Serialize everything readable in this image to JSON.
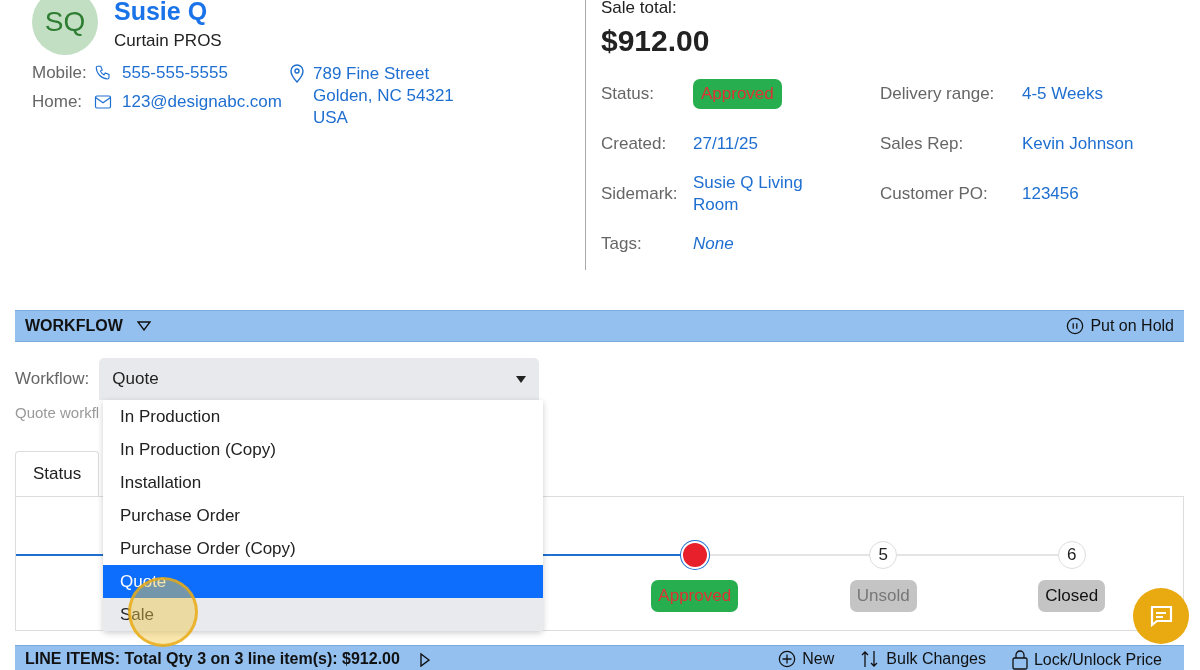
{
  "customer": {
    "initials": "SQ",
    "name": "Susie Q",
    "company": "Curtain PROS",
    "contacts": [
      {
        "kind": "phone",
        "label": "Mobile:",
        "value": "555-555-5555"
      },
      {
        "kind": "email",
        "label": "Home:",
        "value": "123@designabc.com"
      }
    ],
    "address": [
      "789 Fine Street",
      "Golden, NC 54321",
      "USA"
    ]
  },
  "sale": {
    "total_label": "Sale total:",
    "total": "$912.00",
    "fields": [
      {
        "label": "Status:",
        "value": "Approved",
        "kind": "badge"
      },
      {
        "label": "Delivery range:",
        "value": "4-5 Weeks",
        "kind": "link"
      },
      {
        "label": "Created:",
        "value": "27/11/25",
        "kind": "link"
      },
      {
        "label": "Sales Rep:",
        "value": "Kevin Johnson",
        "kind": "link"
      },
      {
        "label": "Sidemark:",
        "value": "Susie Q Living Room",
        "kind": "link"
      },
      {
        "label": "Customer PO:",
        "value": "123456",
        "kind": "link"
      },
      {
        "label": "Tags:",
        "value": "None",
        "kind": "empty"
      }
    ]
  },
  "workflow": {
    "title": "WORKFLOW",
    "hold_button": "Put on Hold",
    "label": "Workflow:",
    "value": "Quote",
    "expanded": true,
    "hint": "Quote workfl",
    "options": [
      {
        "label": "In Production",
        "selected": false,
        "hovered": false
      },
      {
        "label": "In Production (Copy)",
        "selected": false,
        "hovered": false
      },
      {
        "label": "Installation",
        "selected": false,
        "hovered": false
      },
      {
        "label": "Purchase Order",
        "selected": false,
        "hovered": false
      },
      {
        "label": "Purchase Order (Copy)",
        "selected": false,
        "hovered": false
      },
      {
        "label": "Quote",
        "selected": true,
        "hovered": false
      },
      {
        "label": "Sale",
        "selected": false,
        "hovered": true
      }
    ],
    "tabs": [
      {
        "label": "Status",
        "selected": true
      }
    ],
    "steps": [
      {
        "label": "Approved",
        "current": true,
        "disabled": false
      },
      {
        "number": "5",
        "label": "Unsold",
        "current": false,
        "disabled": true
      },
      {
        "number": "6",
        "label": "Closed",
        "current": false,
        "disabled": false
      }
    ]
  },
  "line_items": {
    "title": "LINE ITEMS: Total Qty 3 on 3 line item(s): $912.00",
    "expanded": false,
    "actions": [
      {
        "kind": "new",
        "label": "New"
      },
      {
        "kind": "bulk",
        "label": "Bulk Changes"
      },
      {
        "kind": "lock",
        "label": "Lock/Unlock Price"
      }
    ]
  }
}
